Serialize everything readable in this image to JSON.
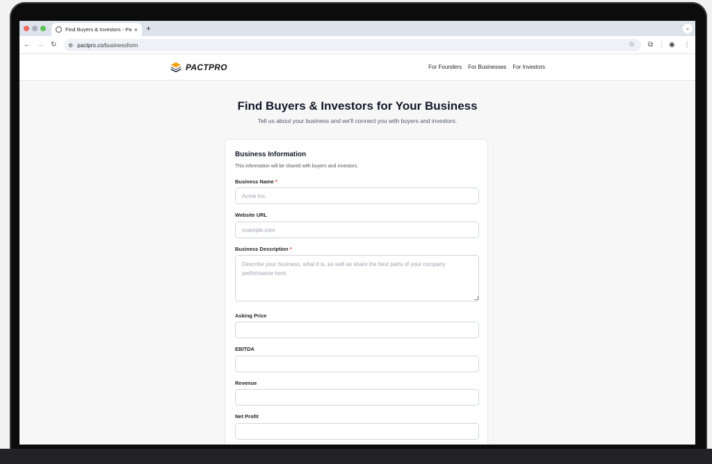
{
  "browser": {
    "tab_title": "Find Buyers & Investors - Pac",
    "tab_close": "×",
    "new_tab": "+",
    "tab_menu": "⌄",
    "url_domain": "pactpro.co",
    "url_path": "/businessform",
    "icons": [
      "back-icon",
      "forward-icon",
      "reload-icon",
      "tune-icon",
      "star-icon",
      "extensions-icon",
      "profile-icon",
      "more-icon"
    ]
  },
  "site": {
    "brand": "PACTPRO",
    "nav": [
      "For Founders",
      "For Businesses",
      "For Investors"
    ]
  },
  "hero": {
    "title": "Find Buyers & Investors for Your Business",
    "subtitle": "Tell us about your business and we'll connect you with buyers and investors."
  },
  "form": {
    "title": "Business Information",
    "description": "This information will be shared with buyers and investors.",
    "required_mark": "*",
    "fields": [
      {
        "label": "Business Name",
        "placeholder": "Acme Inc.",
        "value": ""
      },
      {
        "label": "Website URL",
        "placeholder": "example.com",
        "value": ""
      },
      {
        "label": "Business Description",
        "placeholder": "Describe your business, what it is, as well as share the best parts of your company performance here.",
        "value": ""
      },
      {
        "label": "Asking Price",
        "placeholder": "",
        "value": ""
      },
      {
        "label": "EBITDA",
        "placeholder": "",
        "value": ""
      },
      {
        "label": "Revenue",
        "placeholder": "",
        "value": ""
      },
      {
        "label": "Net Profit",
        "placeholder": "",
        "value": ""
      }
    ]
  },
  "colors": {
    "accent_required": "#dc2626",
    "heading": "#111827",
    "tab_bar": "#dde3ec"
  }
}
